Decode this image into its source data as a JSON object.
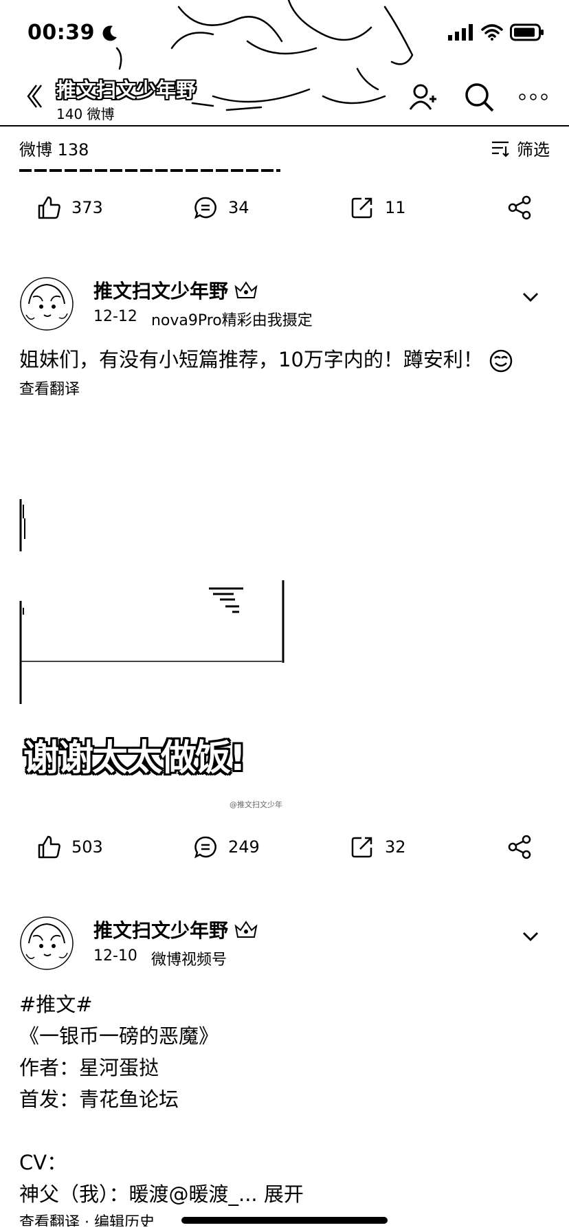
{
  "status_bar": {
    "time": "00:39"
  },
  "nav": {
    "title": "推文扫文少年野",
    "subtitle": "140 微博"
  },
  "subbar": {
    "count_label": "微博 138",
    "filter_label": "筛选"
  },
  "top_actions": {
    "likes": "373",
    "comments": "34",
    "reposts": "11"
  },
  "posts": [
    {
      "author": "推文扫文少年野",
      "date": "12-12",
      "source": "nova9Pro精彩由我摄定",
      "text": "姐妹们，有没有小短篇推荐，10万字内的！蹲安利！",
      "translate": "查看翻译",
      "media_caption": "谢谢太太做饭!",
      "watermark": "@推文扫文少年",
      "likes": "503",
      "comments": "249",
      "reposts": "32"
    },
    {
      "author": "推文扫文少年野",
      "date": "12-10",
      "source": "微博视频号",
      "lines": [
        "#推文#",
        "《一银币一磅的恶魔》",
        "作者：星河蛋挞",
        "首发：青花鱼论坛",
        "",
        "CV：",
        "神父（我）：暖渡@暖渡_... "
      ],
      "expand": "展开",
      "translate": "查看翻译 · 编辑历史"
    }
  ],
  "icons": {
    "back": "chevron-left-icon",
    "follow": "add-user-icon",
    "search": "search-icon",
    "more": "more-dots-icon",
    "filter": "filter-icon",
    "like": "thumb-up-icon",
    "comment": "comment-icon",
    "repost": "repost-icon",
    "share": "share-icon"
  }
}
